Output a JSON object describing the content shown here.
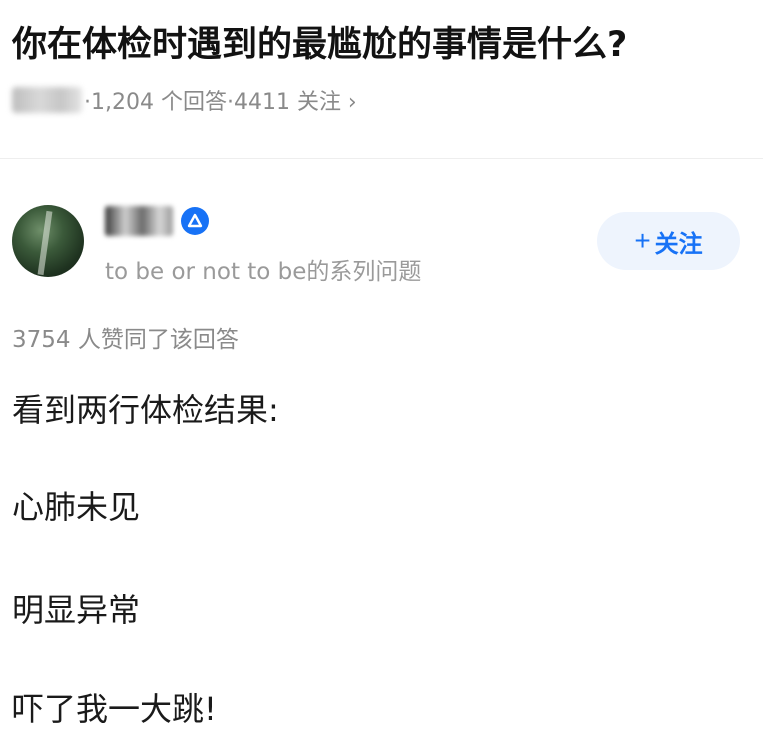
{
  "question": {
    "title": "你在体检时遇到的最尴尬的事情是什么?",
    "meta": "·1,204 个回答·4411 关注 ›"
  },
  "author": {
    "bio": "to be or not to be的系列问题",
    "verified_icon": "verified-badge-icon"
  },
  "follow_button": {
    "label": "关注",
    "icon": "+"
  },
  "answer": {
    "votes": "3754 人赞同了该回答",
    "lines": [
      "看到两行体检结果:",
      "心肺未见",
      "明显异常",
      "吓了我一大跳!"
    ]
  },
  "colors": {
    "accent": "#1772f6",
    "follow_bg": "#eef4fd",
    "meta_gray": "#8a8a8a"
  }
}
